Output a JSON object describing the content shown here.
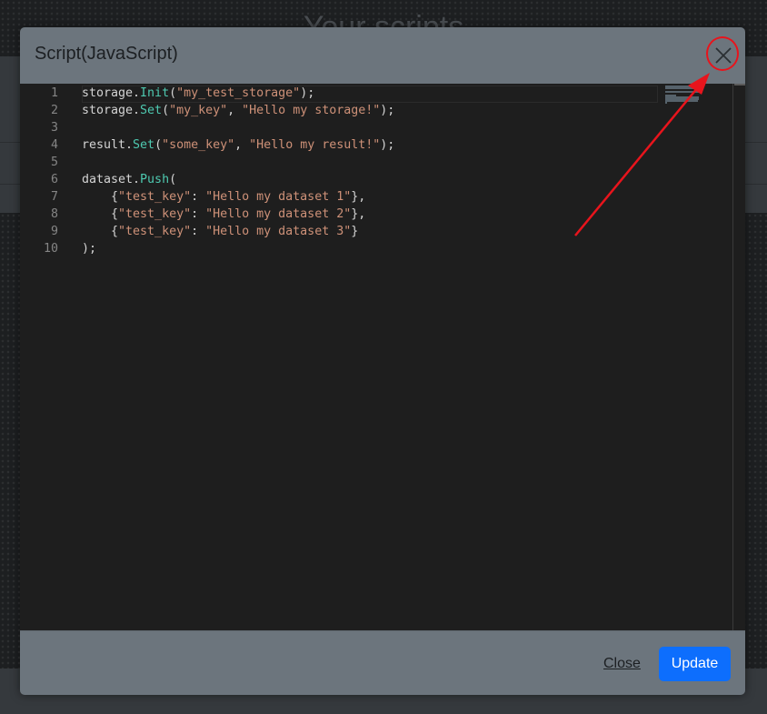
{
  "background": {
    "title": "Your scripts"
  },
  "modal": {
    "title": "Script(JavaScript)",
    "close_icon": "close-icon"
  },
  "editor": {
    "line_numbers": [
      "1",
      "2",
      "3",
      "4",
      "5",
      "6",
      "7",
      "8",
      "9",
      "10"
    ],
    "lines": [
      [
        {
          "t": "storage.",
          "c": "p"
        },
        {
          "t": "Init",
          "c": "fn"
        },
        {
          "t": "(",
          "c": "p"
        },
        {
          "t": "\"my_test_storage\"",
          "c": "str"
        },
        {
          "t": ");",
          "c": "p"
        }
      ],
      [
        {
          "t": "storage.",
          "c": "p"
        },
        {
          "t": "Set",
          "c": "fn"
        },
        {
          "t": "(",
          "c": "p"
        },
        {
          "t": "\"my_key\"",
          "c": "str"
        },
        {
          "t": ", ",
          "c": "p"
        },
        {
          "t": "\"Hello my storage!\"",
          "c": "str"
        },
        {
          "t": ");",
          "c": "p"
        }
      ],
      [],
      [
        {
          "t": "result.",
          "c": "p"
        },
        {
          "t": "Set",
          "c": "fn"
        },
        {
          "t": "(",
          "c": "p"
        },
        {
          "t": "\"some_key\"",
          "c": "str"
        },
        {
          "t": ", ",
          "c": "p"
        },
        {
          "t": "\"Hello my result!\"",
          "c": "str"
        },
        {
          "t": ");",
          "c": "p"
        }
      ],
      [],
      [
        {
          "t": "dataset.",
          "c": "p"
        },
        {
          "t": "Push",
          "c": "fn"
        },
        {
          "t": "(",
          "c": "p"
        }
      ],
      [
        {
          "t": "    {",
          "c": "p"
        },
        {
          "t": "\"test_key\"",
          "c": "str"
        },
        {
          "t": ": ",
          "c": "p"
        },
        {
          "t": "\"Hello my dataset 1\"",
          "c": "str"
        },
        {
          "t": "},",
          "c": "p"
        }
      ],
      [
        {
          "t": "    {",
          "c": "p"
        },
        {
          "t": "\"test_key\"",
          "c": "str"
        },
        {
          "t": ": ",
          "c": "p"
        },
        {
          "t": "\"Hello my dataset 2\"",
          "c": "str"
        },
        {
          "t": "},",
          "c": "p"
        }
      ],
      [
        {
          "t": "    {",
          "c": "p"
        },
        {
          "t": "\"test_key\"",
          "c": "str"
        },
        {
          "t": ": ",
          "c": "p"
        },
        {
          "t": "\"Hello my dataset 3\"",
          "c": "str"
        },
        {
          "t": "}",
          "c": "p"
        }
      ],
      [
        {
          "t": ");",
          "c": "p"
        }
      ]
    ]
  },
  "footer": {
    "close_label": "Close",
    "update_label": "Update"
  },
  "colors": {
    "modal_bg": "#6c757d",
    "editor_bg": "#1e1e1e",
    "primary": "#0d6efd",
    "annotation": "#e8141c",
    "function": "#4ec9b0",
    "string": "#ce9178"
  }
}
